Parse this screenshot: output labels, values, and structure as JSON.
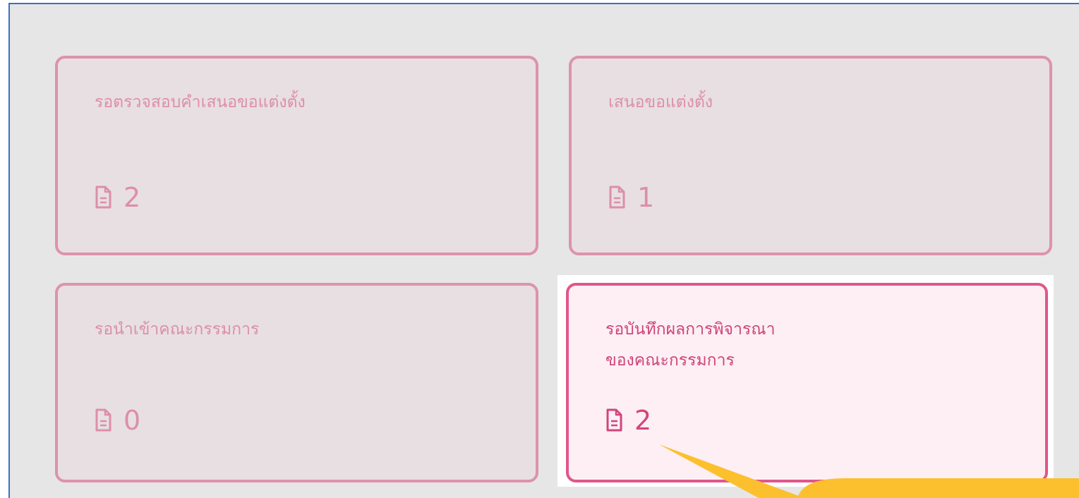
{
  "cards": [
    {
      "title": "รอตรวจสอบคำเสนอขอแต่งตั้ง",
      "count": "2",
      "icon": "document-icon"
    },
    {
      "title": "เสนอขอแต่งตั้ง",
      "count": "1",
      "icon": "document-icon"
    },
    {
      "title": "รอนำเข้าคณะกรรมการ",
      "count": "0",
      "icon": "document-icon"
    },
    {
      "title": "รอบันทึกผลการพิจารณา\nของคณะกรรมการ",
      "count": "2",
      "icon": "document-icon",
      "highlighted": true
    }
  ],
  "colors": {
    "card_border": "#dd93ab",
    "card_bg": "#e8dfe3",
    "active_border": "#e0578a",
    "active_bg": "#fdeff4",
    "callout": "#fcc02e",
    "frame_border": "#3a6fc4"
  }
}
